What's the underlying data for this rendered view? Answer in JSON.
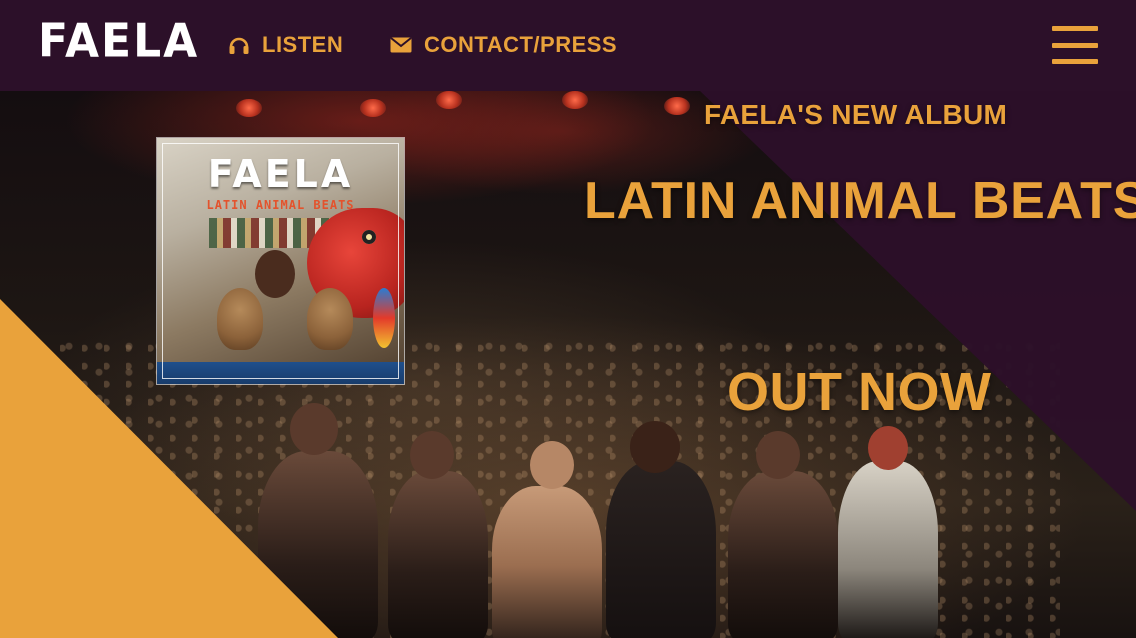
{
  "brand": {
    "logo_text": "FAELA"
  },
  "nav": {
    "items": [
      {
        "label": "LISTEN",
        "icon": "headphones-icon"
      },
      {
        "label": "CONTACT/PRESS",
        "icon": "envelope-icon"
      }
    ],
    "menu_icon": "hamburger-menu-icon"
  },
  "hero": {
    "kicker": "FAELA'S NEW ALBUM",
    "album_title": "LATIN ANIMAL BEATS",
    "cta": "OUT NOW",
    "album_cover": {
      "band": "FAELA",
      "subtitle": "LATIN ANIMAL BEATS"
    }
  },
  "colors": {
    "header_bg": "#2c1029",
    "accent": "#e9a23b",
    "logo": "#ffffff"
  }
}
